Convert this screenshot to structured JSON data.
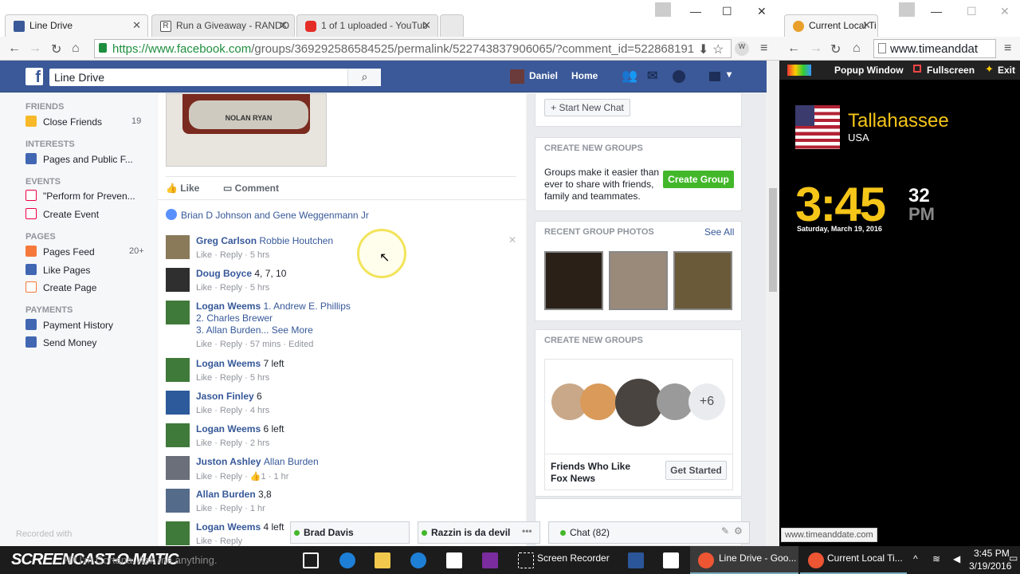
{
  "left_browser": {
    "tabs": [
      {
        "label": "Line Drive",
        "color": "#3b5998"
      },
      {
        "label": "Run a Giveaway - RANDO",
        "color": "#555555"
      },
      {
        "label": "1 of 1 uploaded - YouTub",
        "color": "#e52d27"
      }
    ],
    "url_host": "https://www.facebook.com",
    "url_path": "/groups/369292586584525/permalink/522743837906065/?comment_id=522868191"
  },
  "facebook": {
    "search_value": "Line Drive",
    "user": "Daniel",
    "home": "Home"
  },
  "sidebar": {
    "friends_header": "FRIENDS",
    "close_friends": "Close Friends",
    "close_friends_count": "19",
    "interests_header": "INTERESTS",
    "pages_public": "Pages and Public F...",
    "events_header": "EVENTS",
    "event_item": "\"Perform for Preven...",
    "create_event": "Create Event",
    "pages_header": "PAGES",
    "pages_feed": "Pages Feed",
    "pages_feed_count": "20+",
    "like_pages": "Like Pages",
    "create_page": "Create Page",
    "payments_header": "PAYMENTS",
    "payment_history": "Payment History",
    "send_money": "Send Money"
  },
  "post": {
    "card_text": "NOLAN RYAN",
    "like": "Like",
    "comment": "Comment",
    "likers": "Brian D Johnson and Gene Weggenmann Jr"
  },
  "comments": [
    {
      "name": "Greg Carlson",
      "tag": "Robbie Houtchen",
      "text": "",
      "actions": "Like · Reply · 5 hrs"
    },
    {
      "name": "Doug Boyce",
      "tag": "",
      "text": "4, 7, 10",
      "actions": "Like · Reply · 5 hrs"
    },
    {
      "name": "Logan Weems",
      "tag": "",
      "text": "1. Andrew E. Phillips",
      "line2": "2. Charles Brewer",
      "line3": "3. Allan Burden... See More",
      "actions": "Like · Reply · 57 mins · Edited"
    },
    {
      "name": "Logan Weems",
      "tag": "",
      "text": "7 left",
      "actions": "Like · Reply · 5 hrs"
    },
    {
      "name": "Jason Finley",
      "tag": "",
      "text": "6",
      "actions": "Like · Reply · 4 hrs"
    },
    {
      "name": "Logan Weems",
      "tag": "",
      "text": "6 left",
      "actions": "Like · Reply · 2 hrs"
    },
    {
      "name": "Juston Ashley",
      "tag": "Allan Burden",
      "text": "",
      "actions": "Like · Reply · 👍1 · 1 hr"
    },
    {
      "name": "Allan Burden",
      "tag": "",
      "text": "3,8",
      "actions": "Like · Reply · 1 hr"
    },
    {
      "name": "Logan Weems",
      "tag": "",
      "text": "4 left",
      "actions": "Like · Reply"
    }
  ],
  "right_column": {
    "start_chat": "Start New Chat",
    "create_groups_title": "CREATE NEW GROUPS",
    "create_groups_text": "Groups make it easier than ever to share with friends, family and teammates.",
    "create_group_btn": "Create Group",
    "photos_title": "RECENT GROUP PHOTOS",
    "see_all": "See All",
    "create_groups_title2": "CREATE NEW GROUPS",
    "plus_count": "+6",
    "fox_text": "Friends Who Like Fox News",
    "get_started": "Get Started"
  },
  "chat": {
    "brad": "Brad Davis",
    "razzin": "Razzin is da devil",
    "chat_label": "Chat (82)"
  },
  "right_browser": {
    "tab_label": "Current Local Ti",
    "url": "www.timeanddat",
    "popup": "Popup Window",
    "fullscreen": "Fullscreen",
    "exit": "Exit",
    "city": "Tallahassee",
    "country": "USA",
    "time": "3:45",
    "seconds": "32",
    "ampm": "PM",
    "date": "Saturday, March 19, 2016",
    "status_url": "www.timeanddate.com"
  },
  "watermark": {
    "recorded": "Recorded with",
    "brand": "SCREENCAST-O-MATIC"
  },
  "taskbar": {
    "search_placeholder": "Hi! I'm Cortana. Ask me anything.",
    "screen_recorder": "Screen Recorder",
    "line_drive": "Line Drive - Goo...",
    "current_local": "Current Local Ti...",
    "clock_time": "3:45 PM",
    "clock_date": "3/19/2016"
  }
}
